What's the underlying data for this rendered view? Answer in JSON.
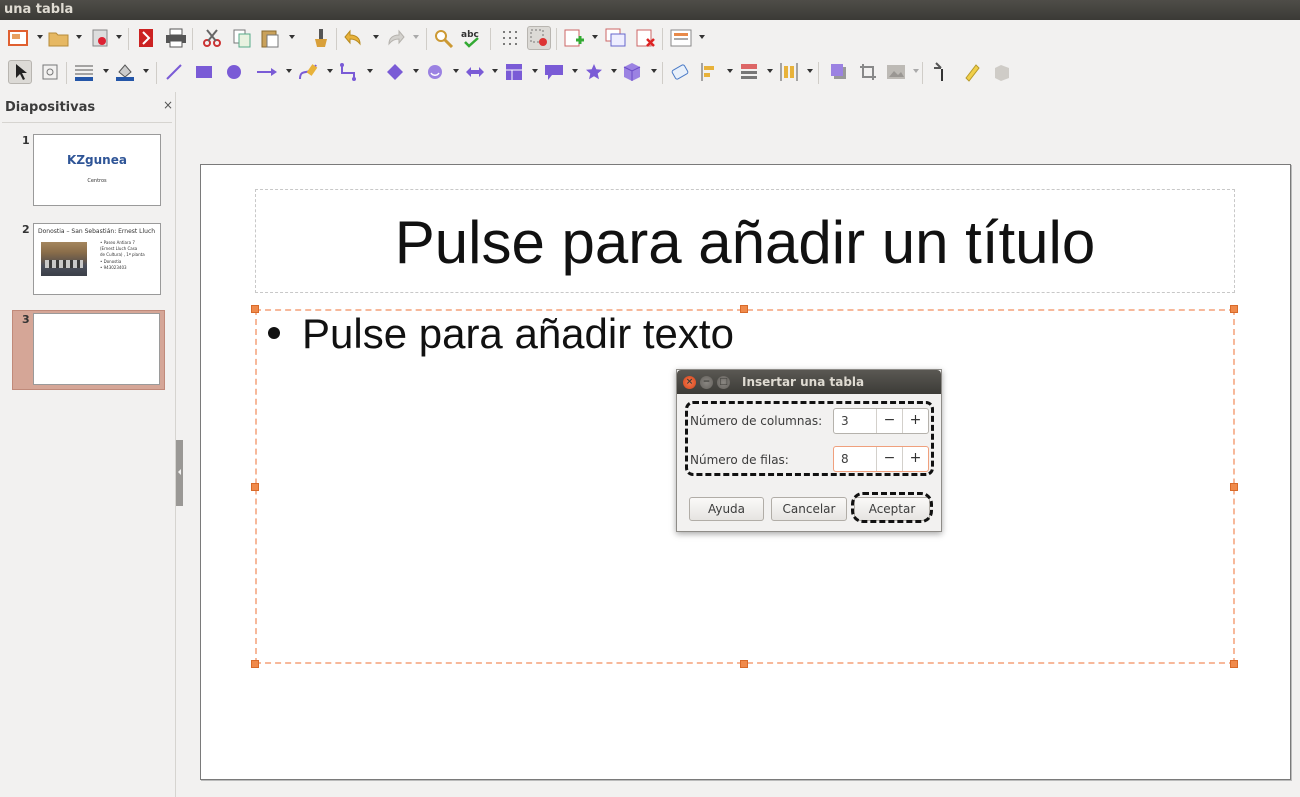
{
  "window": {
    "title": "una tabla"
  },
  "sidebar": {
    "title": "Diapositivas",
    "close_glyph": "×",
    "slides": [
      {
        "number": "1",
        "title": "KZgunea",
        "subtitle": "Centros"
      },
      {
        "number": "2",
        "title": "Donostia – San Sebastián: Ernest Lluch",
        "bullets": [
          "• Paseo Antiara 7",
          "(Ernest Lluch Casa",
          "de Cultura) , 1ª planta",
          "• Donostia",
          "• 943023403"
        ]
      },
      {
        "number": "3",
        "selected": true
      }
    ]
  },
  "slide": {
    "title_placeholder": "Pulse para añadir un título",
    "content_placeholder": "Pulse para añadir texto"
  },
  "dialog": {
    "title": "Insertar una tabla",
    "columns_label": "Número de columnas:",
    "columns_value": "3",
    "rows_label": "Número de filas:",
    "rows_value": "8",
    "minus_glyph": "−",
    "plus_glyph": "+",
    "help_button": "Ayuda",
    "cancel_button": "Cancelar",
    "accept_button": "Aceptar"
  },
  "colors": {
    "selection_orange": "#f08a4b",
    "title_blue": "#2f5597",
    "window_chrome": "#3c3b37"
  }
}
